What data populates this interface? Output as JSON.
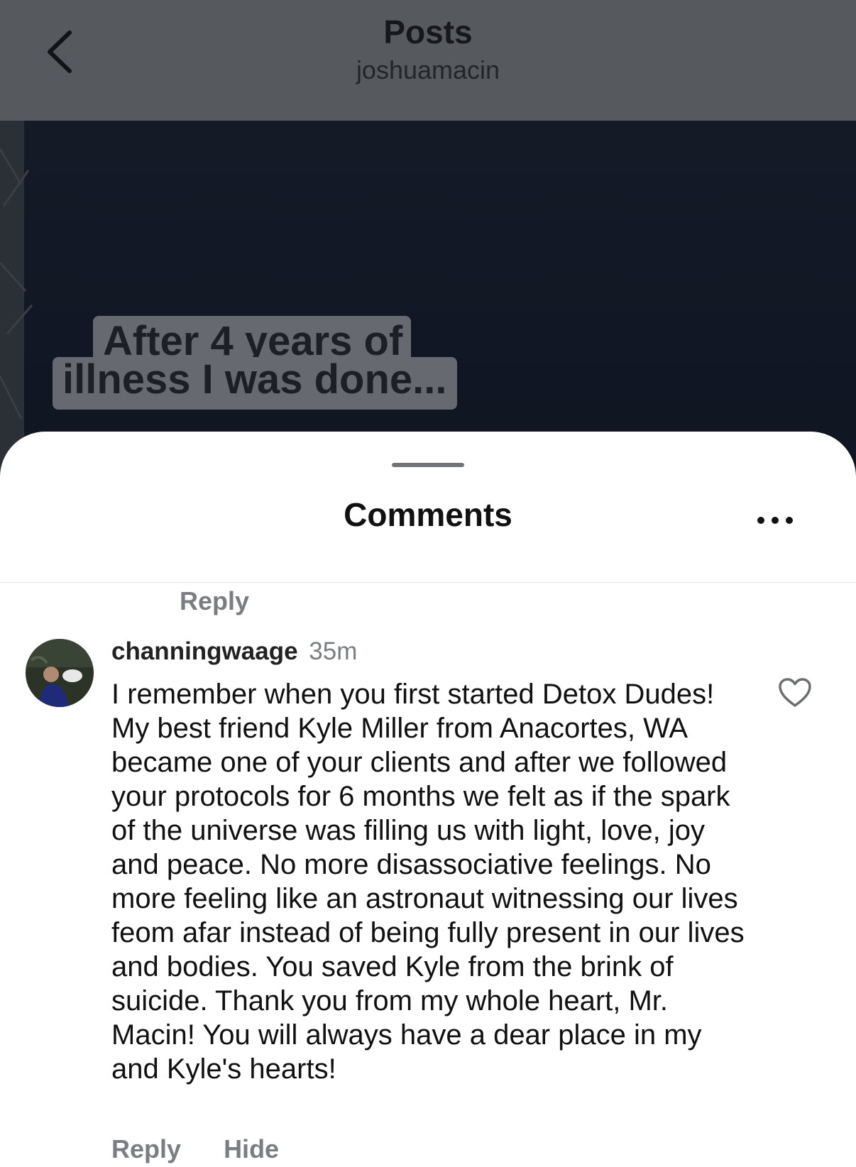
{
  "header": {
    "title": "Posts",
    "subtitle": "joshuamacin"
  },
  "post": {
    "caption_line1": "After 4 years of",
    "caption_line2": "illness I was done..."
  },
  "comments_sheet": {
    "title": "Comments",
    "previous_reply_label": "Reply",
    "comment": {
      "username": "channingwaage",
      "timestamp": "35m",
      "text": "I remember when you first started Detox Dudes! My best friend Kyle Miller from Anacortes, WA became one of your clients and after we followed your protocols for 6 months we felt as if the spark of the universe was filling us with light, love, joy and peace. No more disassociative feelings. No more feeling like an astronaut witnessing our lives feom afar instead of being fully present in our lives and bodies. You saved Kyle from the brink of suicide. Thank you from my whole heart, Mr. Macin! You will always have a dear place in my and Kyle's hearts!",
      "reply_label": "Reply",
      "hide_label": "Hide"
    }
  },
  "icons": {
    "back": "chevron-left-icon",
    "more": "more-horizontal-icon",
    "like": "heart-outline-icon"
  },
  "colors": {
    "header_dim": "#565a5f",
    "media_dark": "#121826",
    "secondary_text": "#7a7d82",
    "primary_text": "#111111"
  }
}
